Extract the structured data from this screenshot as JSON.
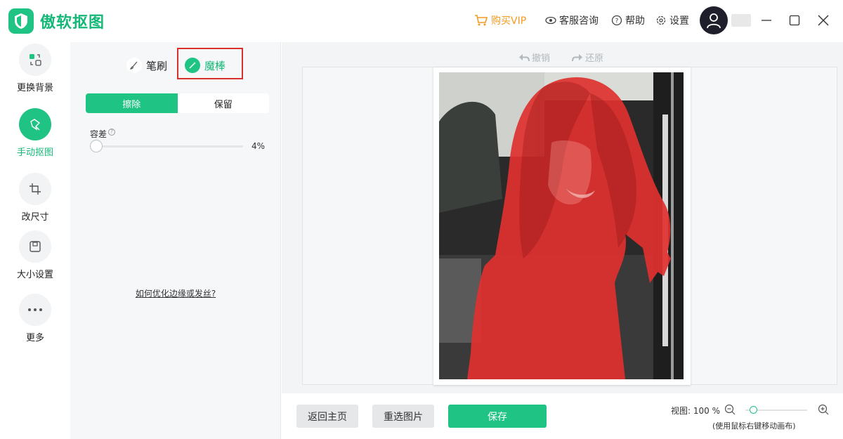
{
  "app": {
    "title": "傲软抠图"
  },
  "titlebar": {
    "buy_vip": "购买VIP",
    "support": "客服咨询",
    "help": "帮助",
    "settings": "设置"
  },
  "nav": {
    "items": [
      {
        "label": "更换背景",
        "icon": "swap-background-icon"
      },
      {
        "label": "手动抠图",
        "icon": "manual-cutout-icon",
        "active": true
      },
      {
        "label": "改尺寸",
        "icon": "crop-icon"
      },
      {
        "label": "大小设置",
        "icon": "size-settings-icon"
      },
      {
        "label": "更多",
        "icon": "more-icon"
      }
    ]
  },
  "tools": {
    "brush": "笔刷",
    "magic_wand": "魔棒",
    "erase": "擦除",
    "keep": "保留",
    "tolerance_label": "容差",
    "tolerance_value": "4%",
    "tolerance_percent": 4,
    "help_link": "如何优化边缘或发丝?"
  },
  "canvas": {
    "undo": "撤销",
    "redo": "还原"
  },
  "bottom": {
    "back_home": "返回主页",
    "reselect": "重选图片",
    "save": "保存",
    "zoom_label": "视图: 100 %",
    "zoom_hint": "(使用鼠标右键移动画布)"
  },
  "colors": {
    "accent": "#1fc383",
    "vip": "#f59a23",
    "highlight": "#d9302f",
    "mask": "#e0312f"
  }
}
